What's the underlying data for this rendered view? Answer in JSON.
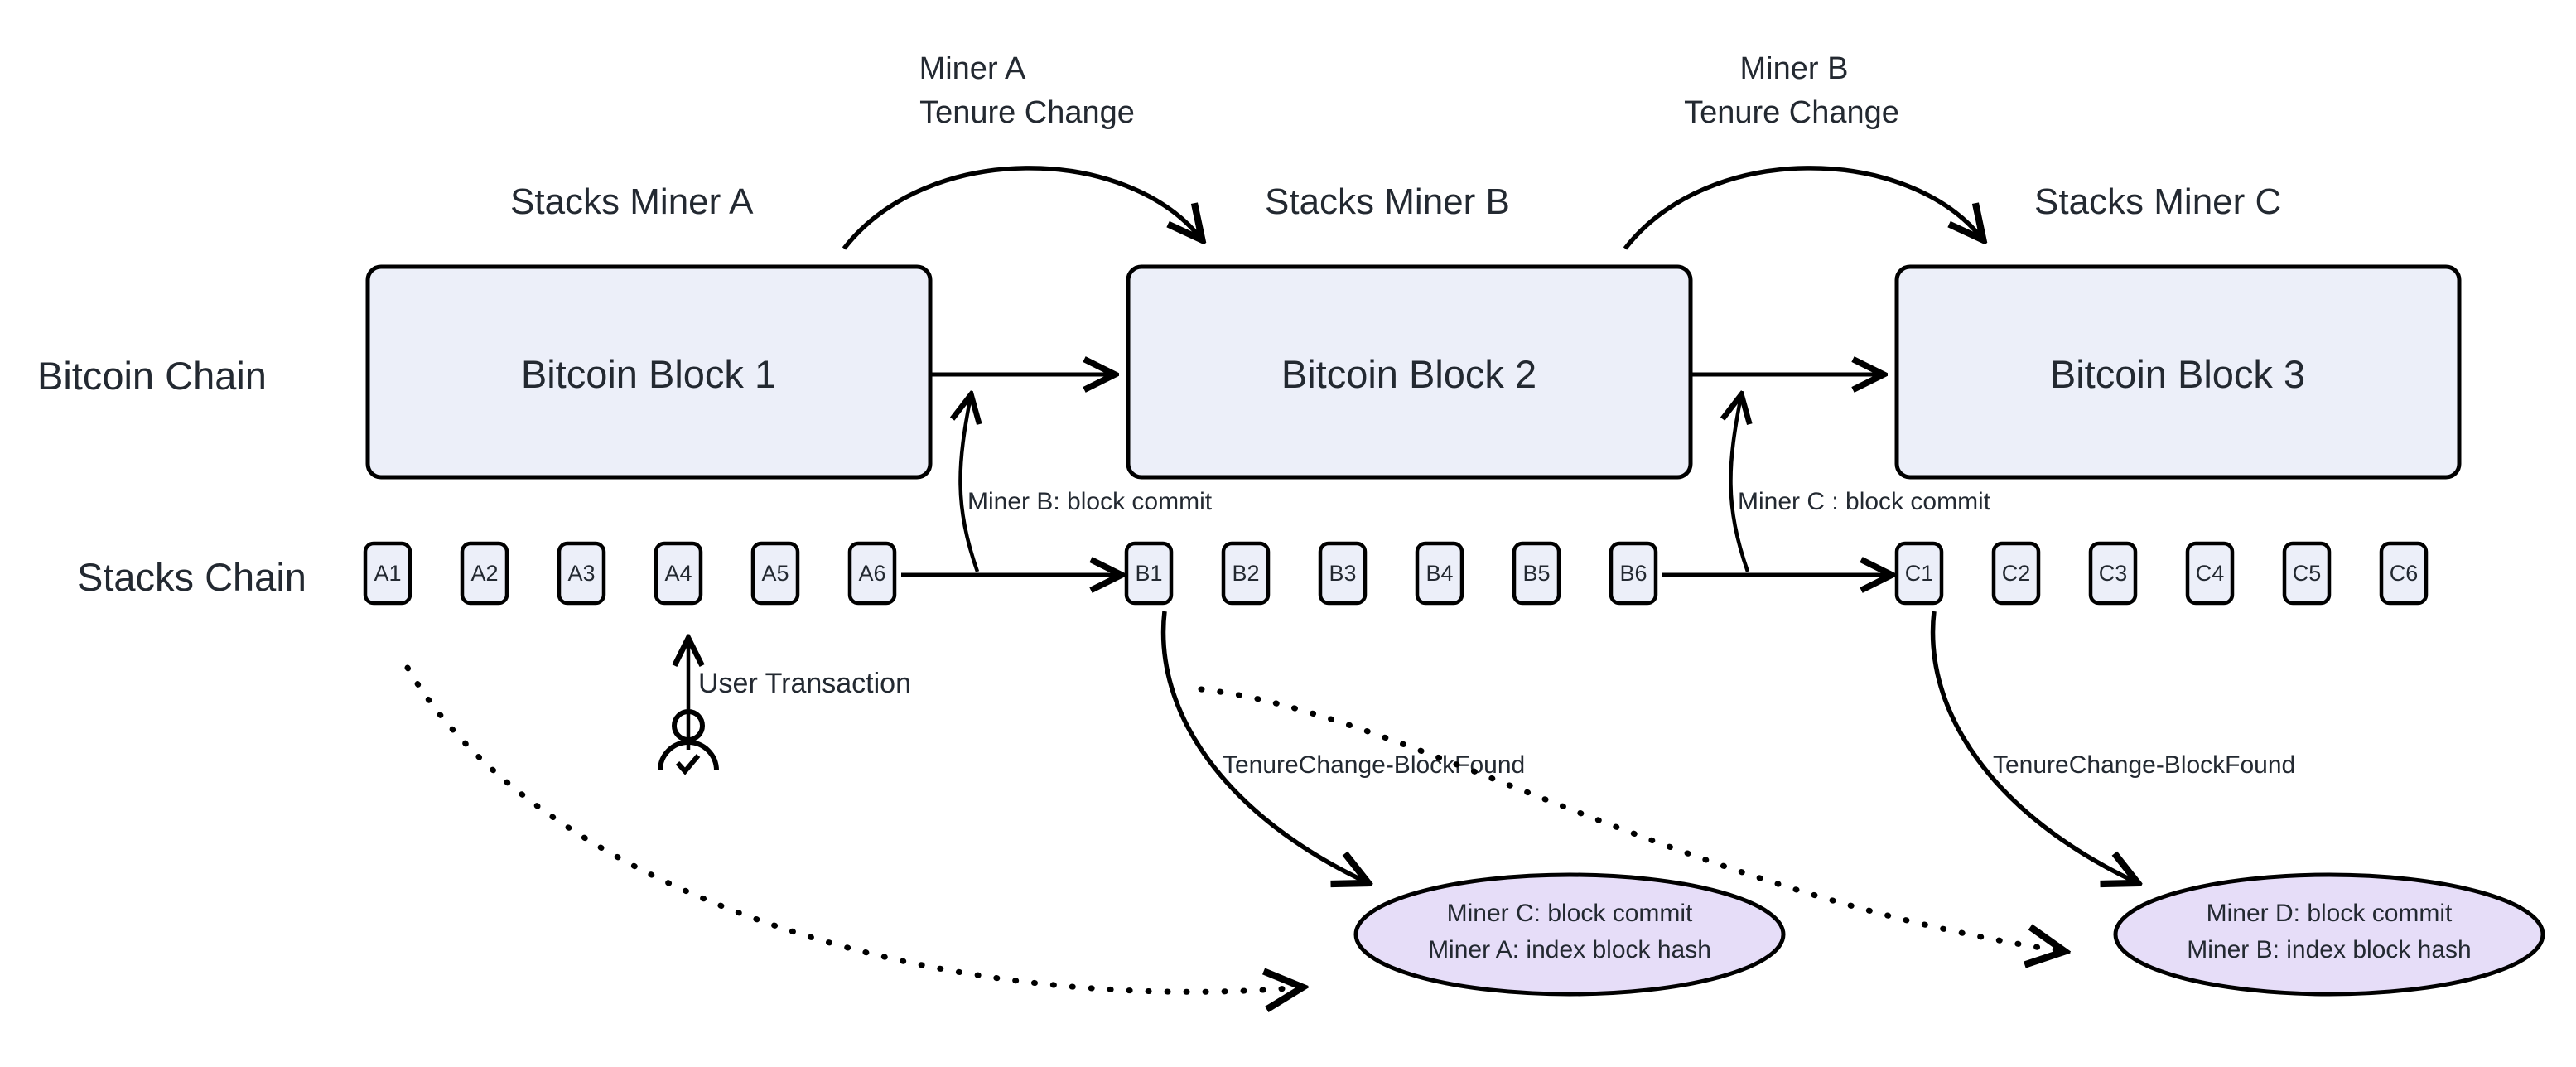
{
  "diagram": {
    "title": "Stacks Nakamoto tenure change over Bitcoin blocks",
    "colors": {
      "block_fill": "#eceff9",
      "ellipse_fill": "#e6ddf8",
      "stroke": "#000000",
      "text": "#232931",
      "background": "#ffffff"
    },
    "row_labels": {
      "bitcoin_chain": "Bitcoin Chain",
      "stacks_chain": "Stacks Chain"
    },
    "miner_headers": [
      {
        "label": "Stacks Miner A"
      },
      {
        "label": "Stacks Miner B"
      },
      {
        "label": "Stacks Miner C"
      }
    ],
    "tenure_change_arcs": [
      {
        "line1": "Miner A",
        "line2": "Tenure Change"
      },
      {
        "line1": "Miner B",
        "line2": "Tenure Change"
      }
    ],
    "bitcoin_blocks": [
      {
        "label": "Bitcoin Block 1"
      },
      {
        "label": "Bitcoin Block 2"
      },
      {
        "label": "Bitcoin Block 3"
      }
    ],
    "stacks_blocks": {
      "tenure_a": [
        "A1",
        "A2",
        "A3",
        "A4",
        "A5",
        "A6"
      ],
      "tenure_b": [
        "B1",
        "B2",
        "B3",
        "B4",
        "B5",
        "B6"
      ],
      "tenure_c": [
        "C1",
        "C2",
        "C3",
        "C4",
        "C5",
        "C6"
      ]
    },
    "block_commit_notes": [
      {
        "text": "Miner B:  block commit"
      },
      {
        "text": "Miner C : block commit"
      }
    ],
    "tenure_change_notes": [
      {
        "text": "TenureChange-BlockFound"
      },
      {
        "text": "TenureChange-BlockFound"
      }
    ],
    "user_transaction": {
      "label": "User Transaction",
      "icon": "user-check-icon"
    },
    "ellipses": [
      {
        "line1": "Miner C:  block commit",
        "line2": "Miner A:  index block hash"
      },
      {
        "line1": "Miner D:  block commit",
        "line2": "Miner B:  index block hash"
      }
    ]
  }
}
